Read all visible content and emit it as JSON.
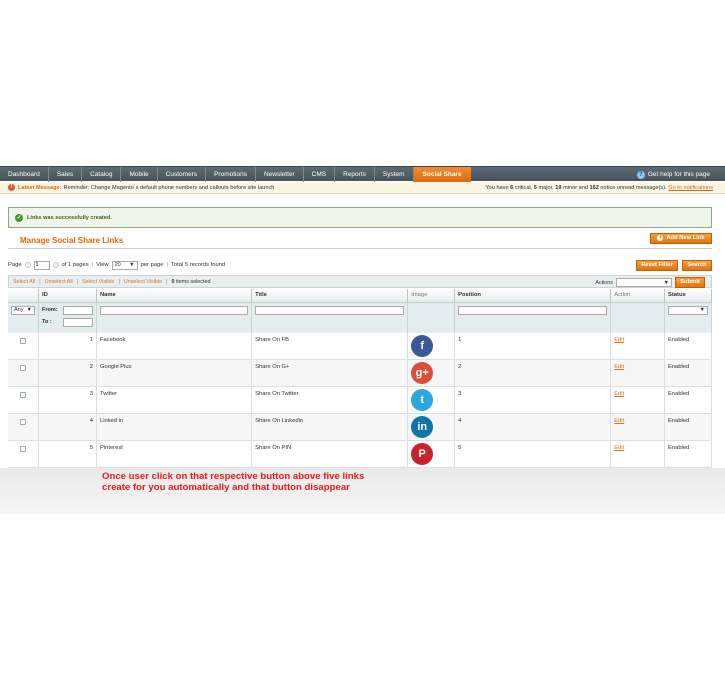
{
  "nav": {
    "items": [
      "Dashboard",
      "Sales",
      "Catalog",
      "Mobile",
      "Customers",
      "Promotions",
      "Newsletter",
      "CMS",
      "Reports",
      "System",
      "Social Share"
    ],
    "active_index": 10,
    "help": "Get help for this page"
  },
  "notice": {
    "label": "Latest Message:",
    "text": "Reminder: Change Magento`s default phone numbers and callouts before site launch",
    "right_prefix": "You have",
    "critical_count": "6",
    "critical_label": "critical,",
    "major_count": "5",
    "major_label": "major,",
    "minor_count": "19",
    "minor_label": "minor and",
    "notice_count": "162",
    "notice_label": "notice unread message(s).",
    "link": "Go to notifications"
  },
  "success_message": "Links was successfully created.",
  "page_title": "Manage Social Share Links",
  "add_button": "Add New Link",
  "pager": {
    "page_label": "Page",
    "page_value": "1",
    "of_pages": "of 1 pages",
    "view_label": "View",
    "per_page_value": "20",
    "per_page_label": "per page",
    "total": "Total 5 records found",
    "reset_filter": "Reset Filter",
    "search": "Search"
  },
  "massaction": {
    "select_all": "Select All",
    "unselect_all": "Unselect All",
    "select_visible": "Select Visible",
    "unselect_visible": "Unselect Visible",
    "selected_count": "0",
    "selected_label": "items selected",
    "actions_label": "Actions",
    "submit": "Submit"
  },
  "columns": [
    "",
    "ID",
    "Name",
    "Title",
    "Image",
    "Position",
    "Action",
    "Status"
  ],
  "filters": {
    "any": "Any",
    "from": "From:",
    "to": "To :"
  },
  "rows": [
    {
      "id": "1",
      "name": "Facebook",
      "title": "Share On FB",
      "icon": "facebook-icon",
      "glyph": "f",
      "color": "#3b5998",
      "position": "1",
      "action": "Edit",
      "status": "Enabled"
    },
    {
      "id": "2",
      "name": "Google Plus",
      "title": "Share On G+",
      "icon": "google-plus-icon",
      "glyph": "g+",
      "color": "#dd4b39",
      "position": "2",
      "action": "Edit",
      "status": "Enabled"
    },
    {
      "id": "3",
      "name": "Twitter",
      "title": "Share On Twitter",
      "icon": "twitter-icon",
      "glyph": "t",
      "color": "#2ba6de",
      "position": "3",
      "action": "Edit",
      "status": "Enabled"
    },
    {
      "id": "4",
      "name": "Linked in",
      "title": "Share On Linkedin",
      "icon": "linkedin-icon",
      "glyph": "in",
      "color": "#0e76a8",
      "position": "4",
      "action": "Edit",
      "status": "Enabled"
    },
    {
      "id": "5",
      "name": "Pinterest",
      "title": "Share On PIN",
      "icon": "pinterest-icon",
      "glyph": "P",
      "color": "#c8232c",
      "position": "5",
      "action": "Edit",
      "status": "Enabled"
    }
  ],
  "caption": "Once user click on that respective button above five links create for you automatically and that button disappear"
}
